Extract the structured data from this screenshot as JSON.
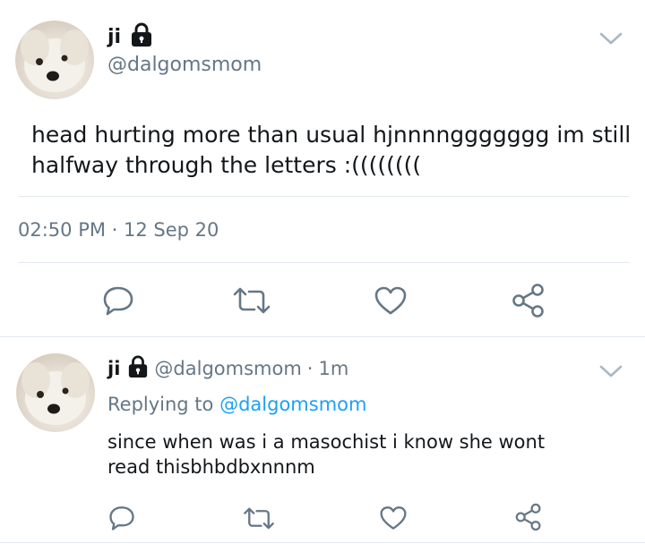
{
  "main_tweet": {
    "display_name": "ji",
    "handle": "@dalgomsmom",
    "text_line1": "head hurting more than usual hjnnnnggggggg im still",
    "text_line2": "halfway through the letters :((((((((",
    "timestamp": "02:50 PM · 12 Sep 20",
    "icons": {
      "avatar": "dog-avatar",
      "verified_lock": "lock-icon",
      "menu": "chevron-down-icon",
      "reply": "reply-icon",
      "retweet": "retweet-icon",
      "like": "heart-icon",
      "share": "share-icon"
    }
  },
  "reply_tweet": {
    "display_name": "ji",
    "handle": "@dalgomsmom",
    "separator": "·",
    "age": "1m",
    "replying_prefix": "Replying to",
    "replying_handle": "@dalgomsmom",
    "text_line1": "since when was i a masochist i know she wont",
    "text_line2": "read thisbhbdbxnnnm"
  },
  "colors": {
    "text": "#14171a",
    "muted": "#657786",
    "link": "#1da1f2",
    "divider": "#e1e8ed",
    "icon": "#657786"
  }
}
